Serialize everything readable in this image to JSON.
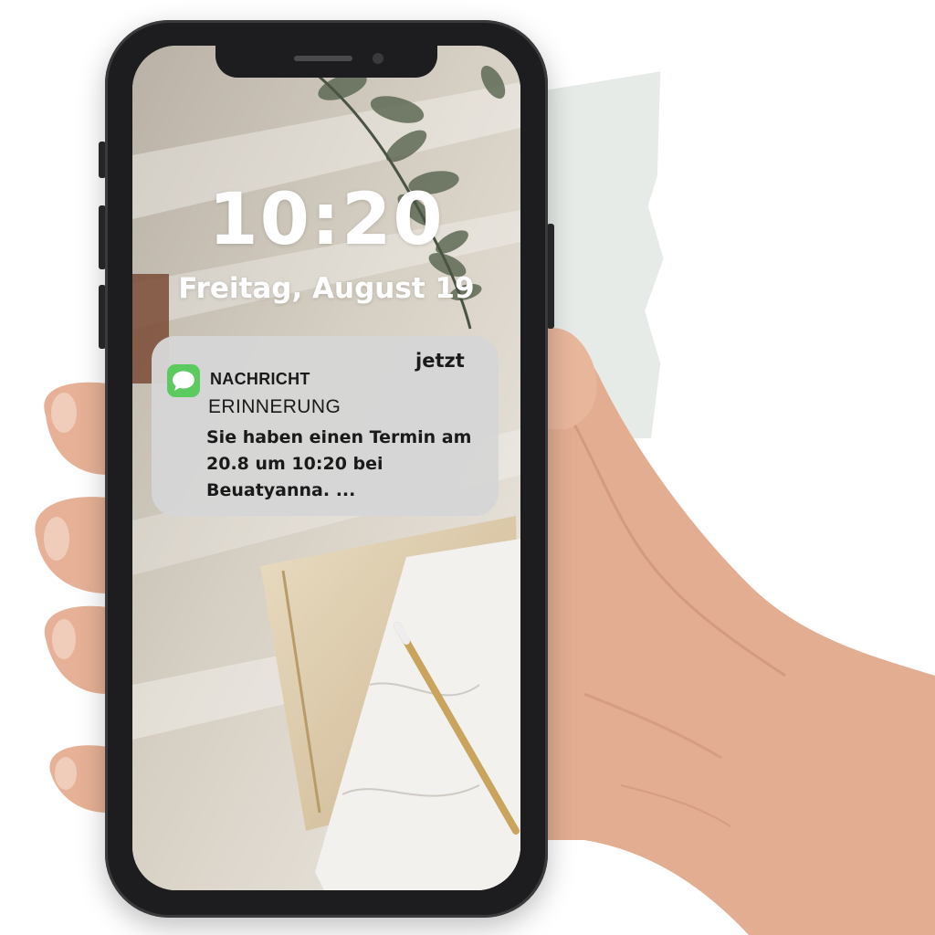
{
  "lockscreen": {
    "time": "10:20",
    "date": "Freitag, August 19"
  },
  "notification": {
    "app_icon": "messages-icon",
    "app_name": "NACHRICHT",
    "timestamp": "jetzt",
    "title": "ERINNERUNG",
    "body": "Sie haben einen Termin am 20.8 um 10:20 bei Beuatyanna. ..."
  },
  "colors": {
    "icon_green": "#5ccb5f",
    "notification_bg": "#d6d6d6",
    "phone_frame": "#1d1d1f"
  }
}
